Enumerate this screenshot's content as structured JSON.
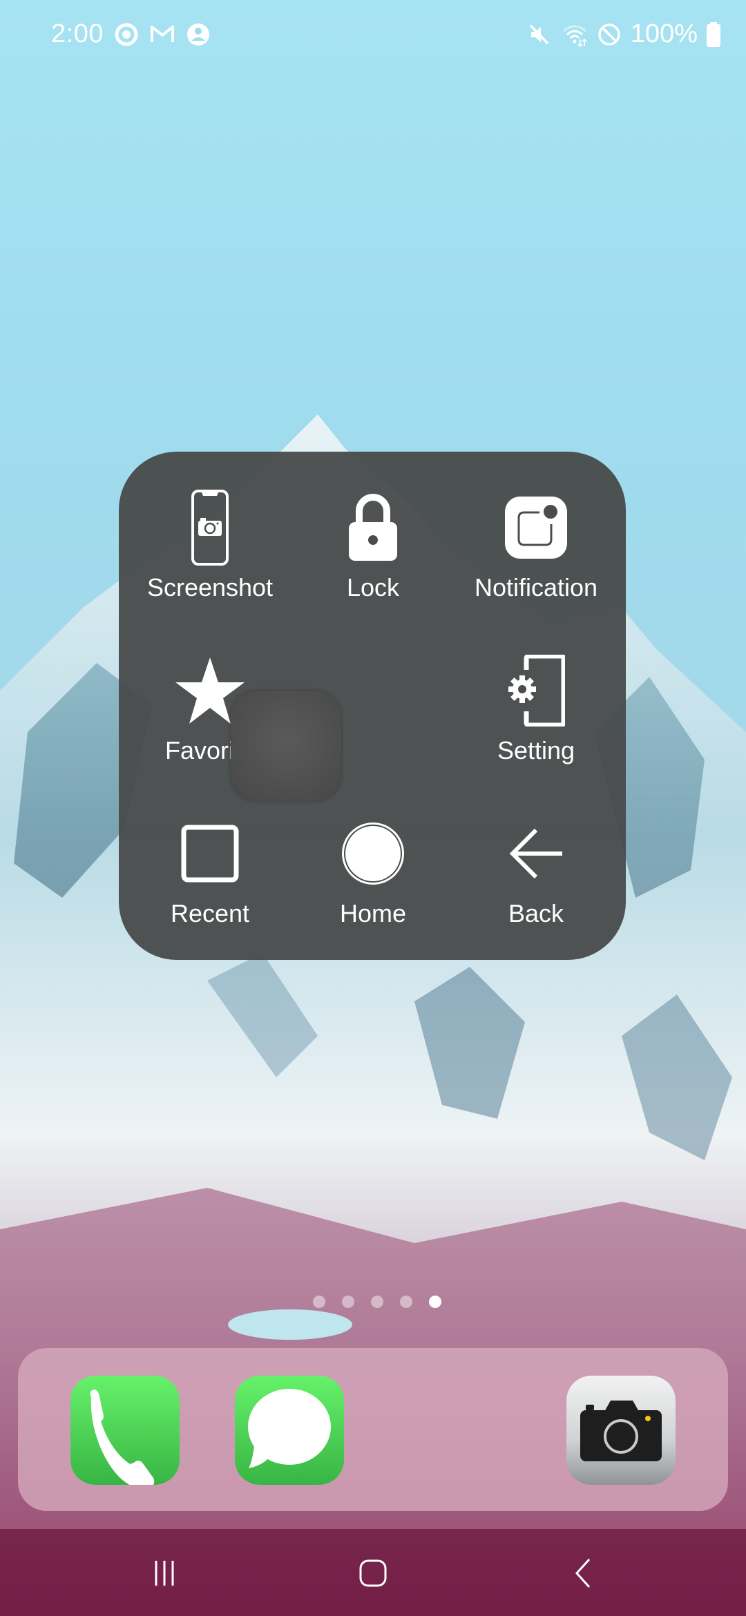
{
  "status_bar": {
    "time": "2:00",
    "left_icons": [
      "screen-record-icon",
      "gmail-icon",
      "account-icon"
    ],
    "right_icons": [
      "mute-icon",
      "wifi-icon",
      "do-not-disturb-icon"
    ],
    "battery_percent": "100%",
    "battery_level": 1.0
  },
  "assistive_menu": {
    "items": [
      {
        "id": "screenshot",
        "label": "Screenshot",
        "icon": "screenshot-phone-icon"
      },
      {
        "id": "lock",
        "label": "Lock",
        "icon": "lock-icon"
      },
      {
        "id": "notification",
        "label": "Notification",
        "icon": "notification-icon"
      },
      {
        "id": "favorite",
        "label": "Favorite",
        "icon": "star-icon"
      },
      {
        "id": "setting",
        "label": "Setting",
        "icon": "phone-settings-icon"
      },
      {
        "id": "recent",
        "label": "Recent",
        "icon": "square-icon"
      },
      {
        "id": "home",
        "label": "Home",
        "icon": "circle-icon"
      },
      {
        "id": "back",
        "label": "Back",
        "icon": "arrow-left-icon"
      }
    ]
  },
  "page_indicator": {
    "total": 5,
    "active_index": 4
  },
  "dock": {
    "apps": [
      {
        "name": "Phone",
        "icon": "phone-icon"
      },
      {
        "name": "Messages",
        "icon": "message-icon"
      },
      {
        "name": "Camera",
        "icon": "camera-icon"
      }
    ]
  },
  "nav_bar": {
    "buttons": [
      "recents",
      "home",
      "back"
    ]
  },
  "colors": {
    "menu_bg": "#484a4a",
    "app_green": "#4cd964",
    "camera_dot": "#f5c518"
  }
}
